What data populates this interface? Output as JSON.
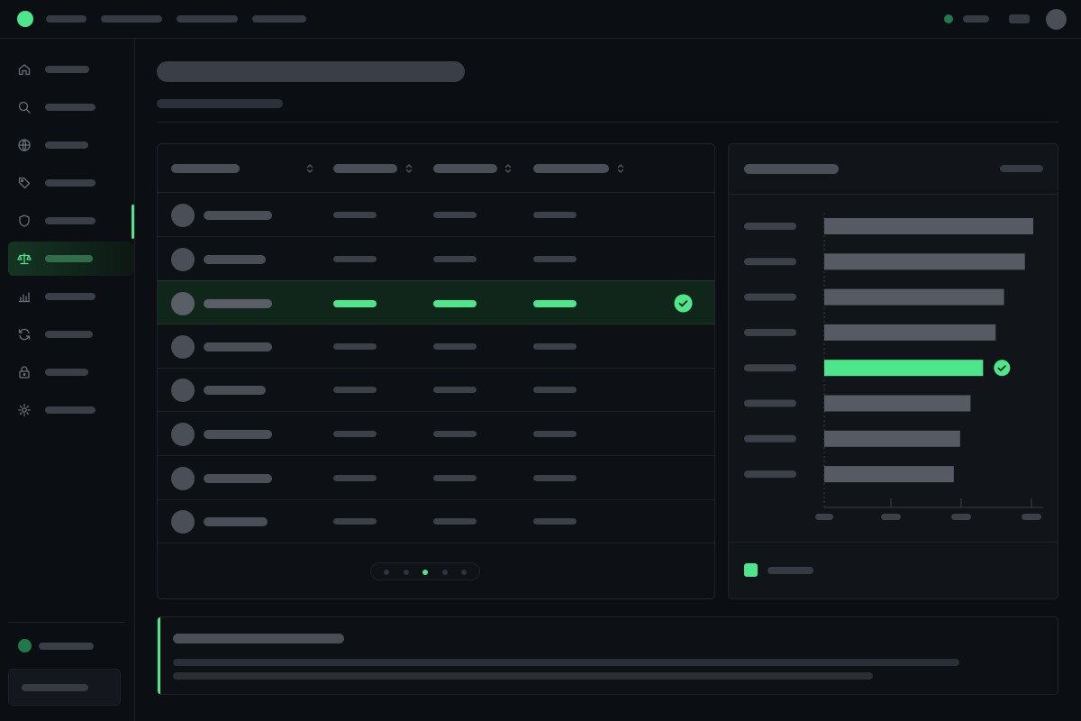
{
  "theme": {
    "accent": "#4ee68a",
    "accent_dark": "#2a8f55",
    "status_dot": "#1f7a47",
    "bar_color": "#565a63"
  },
  "topbar": {
    "logo_icon": "green-dot-logo",
    "nav_links": 4,
    "status_icon": "online-status-dot",
    "avatar_icon": "user-avatar"
  },
  "sidebar": {
    "items": [
      {
        "icon": "home-icon",
        "active": false
      },
      {
        "icon": "search-icon",
        "active": false
      },
      {
        "icon": "globe-icon",
        "active": false
      },
      {
        "icon": "tag-icon",
        "active": false
      },
      {
        "icon": "shield-icon",
        "active": false
      },
      {
        "icon": "scale-icon",
        "active": true
      },
      {
        "icon": "bar-chart-icon",
        "active": false
      },
      {
        "icon": "refresh-icon",
        "active": false
      },
      {
        "icon": "lock-icon",
        "active": false
      },
      {
        "icon": "gear-icon",
        "active": false
      }
    ]
  },
  "table": {
    "columns": 4,
    "sortable_columns": 4,
    "row_count": 8,
    "selected_row": 2,
    "selected_icon": "check-circle-icon",
    "pager": {
      "pages": 5,
      "current": 3
    }
  },
  "chart_data": {
    "type": "bar",
    "orientation": "horizontal",
    "category_count": 8,
    "values": [
      100,
      96,
      86,
      82,
      76,
      70,
      65,
      62
    ],
    "highlight_index": 4,
    "highlight_icon": "check-circle-icon",
    "x_ticks": 4,
    "grid": false,
    "legend_position": "bottom-left"
  }
}
